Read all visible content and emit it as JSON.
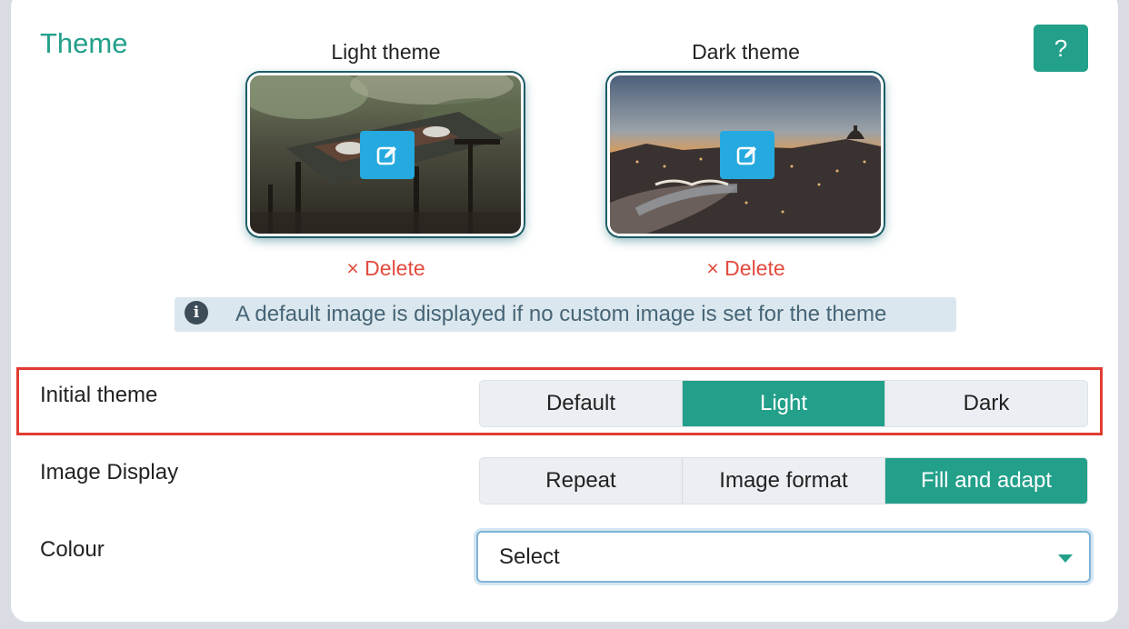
{
  "section": {
    "title": "Theme",
    "help_label": "?"
  },
  "themes": [
    {
      "label": "Light theme",
      "delete_label": "Delete"
    },
    {
      "label": "Dark theme",
      "delete_label": "Delete"
    }
  ],
  "delete_icon": "×",
  "info": {
    "icon": "i",
    "text": "A default image is displayed if no custom image is set for the theme"
  },
  "initial_theme": {
    "label": "Initial theme",
    "options": [
      "Default",
      "Light",
      "Dark"
    ],
    "selected": "Light"
  },
  "image_display": {
    "label": "Image Display",
    "options": [
      "Repeat",
      "Image format",
      "Fill and adapt"
    ],
    "selected": "Fill and adapt"
  },
  "colour": {
    "label": "Colour",
    "value": "Select"
  },
  "colors": {
    "accent": "#23a08a",
    "edit": "#25a9df",
    "danger": "#e24b3d",
    "highlight": "#e03c31"
  }
}
